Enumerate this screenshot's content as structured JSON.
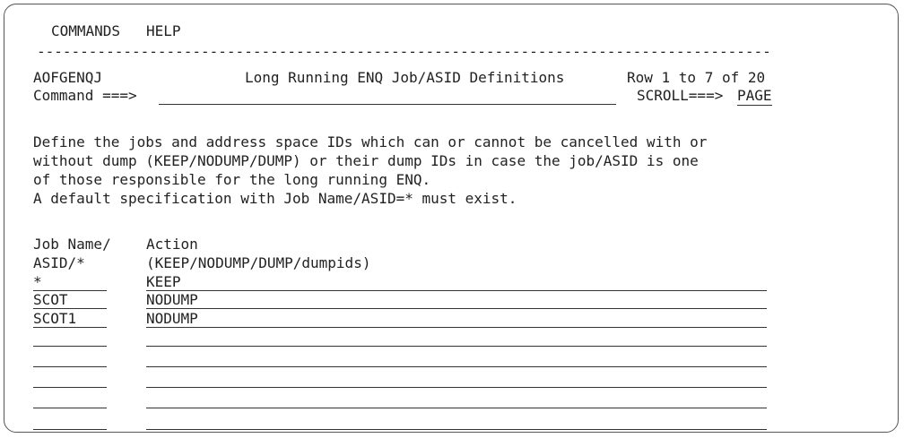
{
  "menu": {
    "commands": "COMMANDS",
    "help": "HELP"
  },
  "header": {
    "panel_id": "AOFGENQJ",
    "title": "Long Running ENQ Job/ASID Definitions",
    "row_info": "Row 1 to 7 of 20",
    "command_label": "Command ===>",
    "command_value": "",
    "scroll_label": "SCROLL===>",
    "scroll_value": "PAGE"
  },
  "description": [
    "Define the jobs and address space IDs which can or cannot be cancelled with or",
    "without dump (KEEP/NODUMP/DUMP) or their dump IDs in case the job/ASID is one",
    "of those responsible for the long running ENQ.",
    "A default specification with Job Name/ASID=* must exist."
  ],
  "columns": {
    "job_header_1": "Job Name/",
    "job_header_2": "ASID/*",
    "action_header_1": "Action",
    "action_header_2": "(KEEP/NODUMP/DUMP/dumpids)"
  },
  "rows": [
    {
      "job": "*",
      "action": "KEEP"
    },
    {
      "job": "SCOT",
      "action": "NODUMP"
    },
    {
      "job": "SCOT1",
      "action": "NODUMP"
    },
    {
      "job": "",
      "action": ""
    },
    {
      "job": "",
      "action": ""
    },
    {
      "job": "",
      "action": ""
    },
    {
      "job": "",
      "action": ""
    }
  ]
}
